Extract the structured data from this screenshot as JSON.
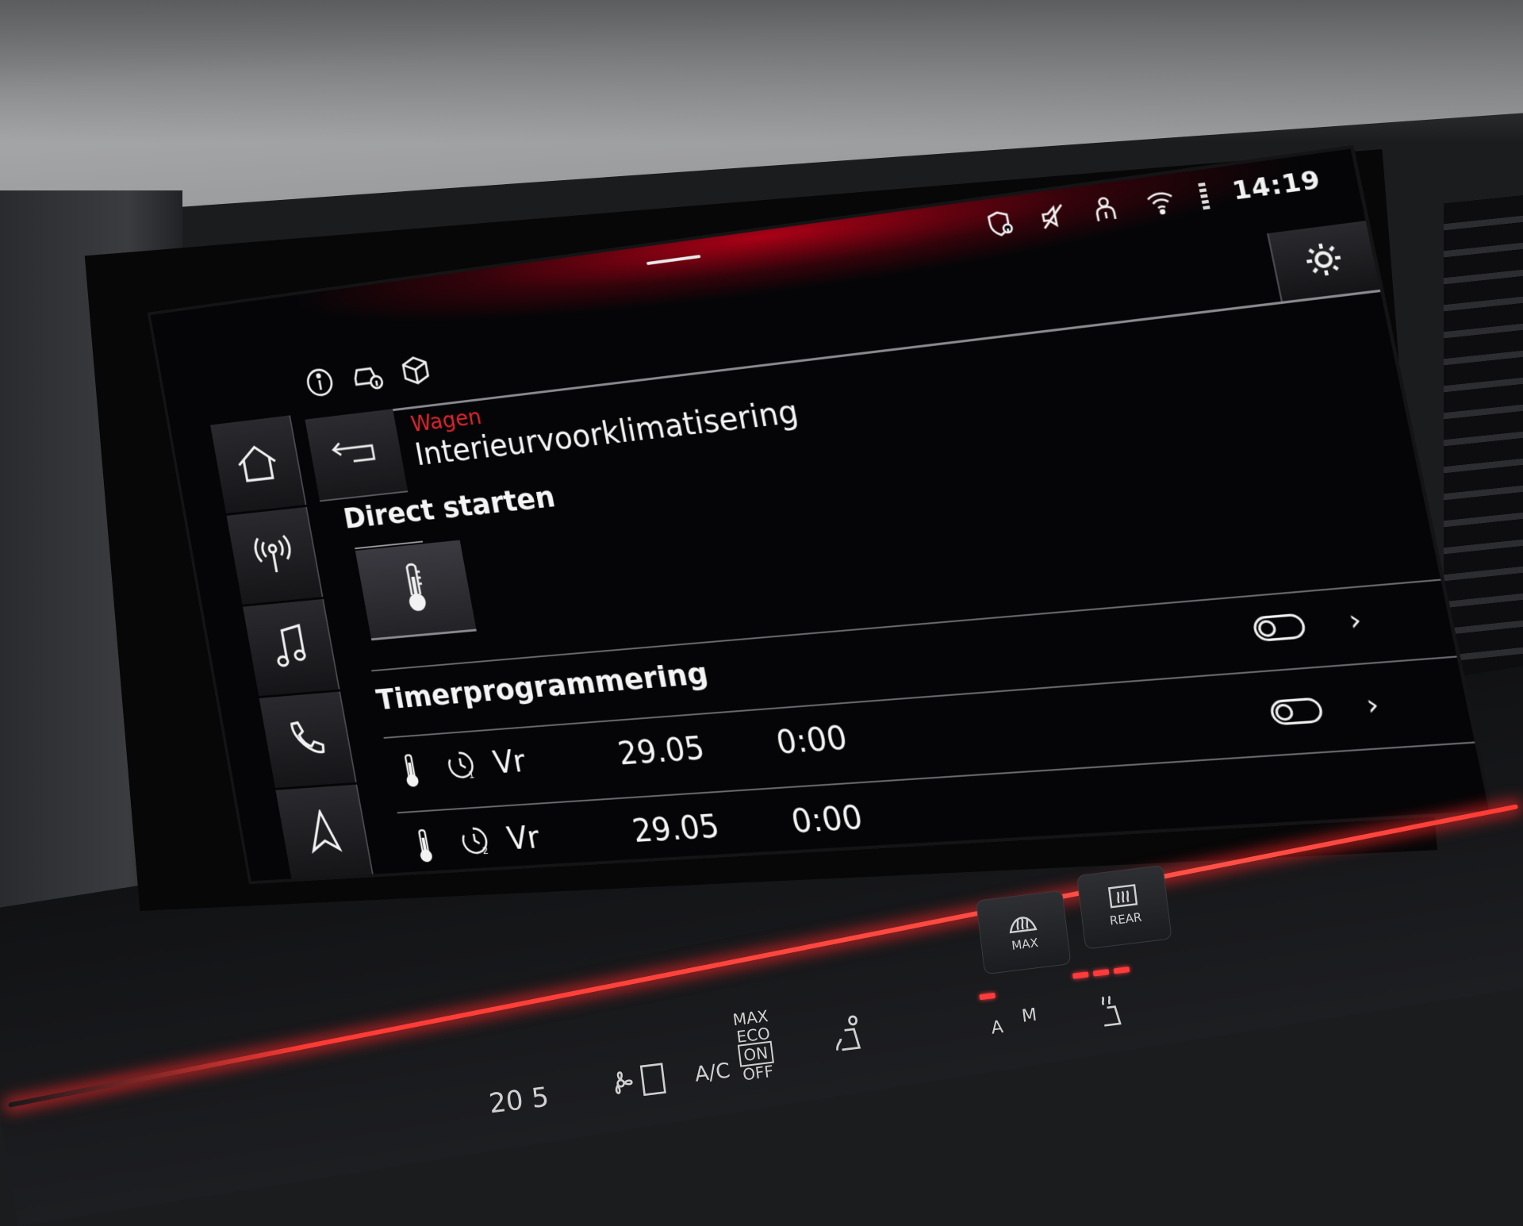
{
  "status_bar": {
    "time": "14:19",
    "icons": [
      "location-shield-icon",
      "muted-speaker-icon",
      "person-info-icon",
      "wifi-icon",
      "signal-bars-icon"
    ]
  },
  "top_icons": [
    "info-icon",
    "car-info-icon",
    "package-icon"
  ],
  "settings": {
    "icon": "gear-icon"
  },
  "header": {
    "breadcrumb": "Wagen",
    "title": "Interieurvoorklimatisering"
  },
  "nav": {
    "items": [
      {
        "id": "home",
        "icon": "home-icon"
      },
      {
        "id": "radio",
        "icon": "radio-antenna-icon"
      },
      {
        "id": "media",
        "icon": "music-note-icon"
      },
      {
        "id": "phone",
        "icon": "phone-icon"
      },
      {
        "id": "navigation",
        "icon": "navigation-arrow-icon"
      }
    ]
  },
  "direct_start": {
    "title": "Direct starten",
    "tile_icon": "thermometer-icon"
  },
  "timer_section": {
    "title": "Timerprogrammering",
    "timers": [
      {
        "day": "Vr",
        "date": "29.05",
        "time": "0:00",
        "timer_icon": "timer-1-icon",
        "enabled": false
      },
      {
        "day": "Vr",
        "date": "29.05",
        "time": "0:00",
        "timer_icon": "timer-2-icon",
        "enabled": false
      }
    ]
  },
  "climate_panel": {
    "temperature": "20 5",
    "ac_label": "A/C",
    "max_label": "MAX",
    "eco_label": "ECO",
    "on_label": "ON",
    "off_label": "OFF",
    "max_defrost_label": "MAX",
    "rear_label": "REAR",
    "auto_a": "A",
    "auto_m": "M"
  },
  "colors": {
    "accent_red": "#e0262d",
    "ambient_red": "#ff3a34",
    "screen_bg": "#050507",
    "text": "#f4f4f4"
  }
}
